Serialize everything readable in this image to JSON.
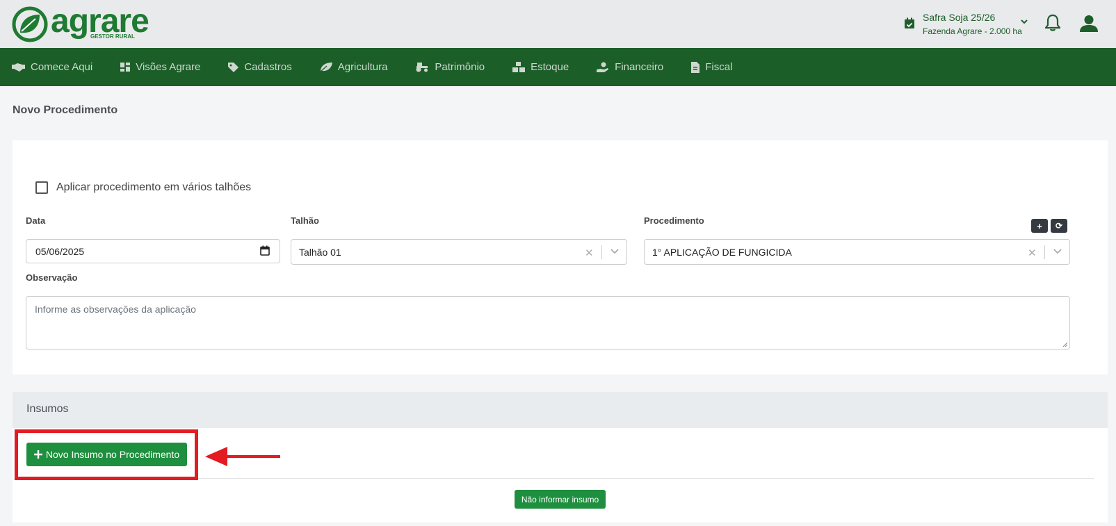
{
  "brand": {
    "name": "agrare",
    "tagline": "GESTOR RURAL",
    "color": "#1f7a32"
  },
  "header": {
    "safra_title": "Safra Soja 25/26",
    "safra_sub": "Fazenda Agrare - 2.000 ha",
    "icons": [
      "calendar-check-icon",
      "chevron-down-icon",
      "bell-icon",
      "user-icon"
    ]
  },
  "nav": {
    "items": [
      {
        "label": "Comece Aqui",
        "icon": "handshake-icon"
      },
      {
        "label": "Visões Agrare",
        "icon": "dashboard-icon"
      },
      {
        "label": "Cadastros",
        "icon": "tag-icon"
      },
      {
        "label": "Agricultura",
        "icon": "leaf-icon"
      },
      {
        "label": "Patrimônio",
        "icon": "tractor-icon"
      },
      {
        "label": "Estoque",
        "icon": "boxes-icon"
      },
      {
        "label": "Financeiro",
        "icon": "money-hand-icon"
      },
      {
        "label": "Fiscal",
        "icon": "invoice-icon"
      }
    ],
    "bg_color": "#1b5e28"
  },
  "page": {
    "title": "Novo Procedimento"
  },
  "form": {
    "checkbox_label": "Aplicar procedimento em vários talhões",
    "data_label": "Data",
    "data_value": "05/06/2025",
    "talhao_label": "Talhão",
    "talhao_value": "Talhão 01",
    "procedimento_label": "Procedimento",
    "procedimento_value": "1° APLICAÇÃO DE FUNGICIDA",
    "add_button": "+",
    "refresh_button": "⟳",
    "observacao_label": "Observação",
    "observacao_placeholder": "Informe as observações da aplicação"
  },
  "insumos": {
    "title": "Insumos",
    "novo_button": "Novo Insumo no Procedimento",
    "nao_informar_button": "Não informar insumo"
  },
  "colors": {
    "accent": "#1e8f3e",
    "highlight": "#e31b23"
  }
}
